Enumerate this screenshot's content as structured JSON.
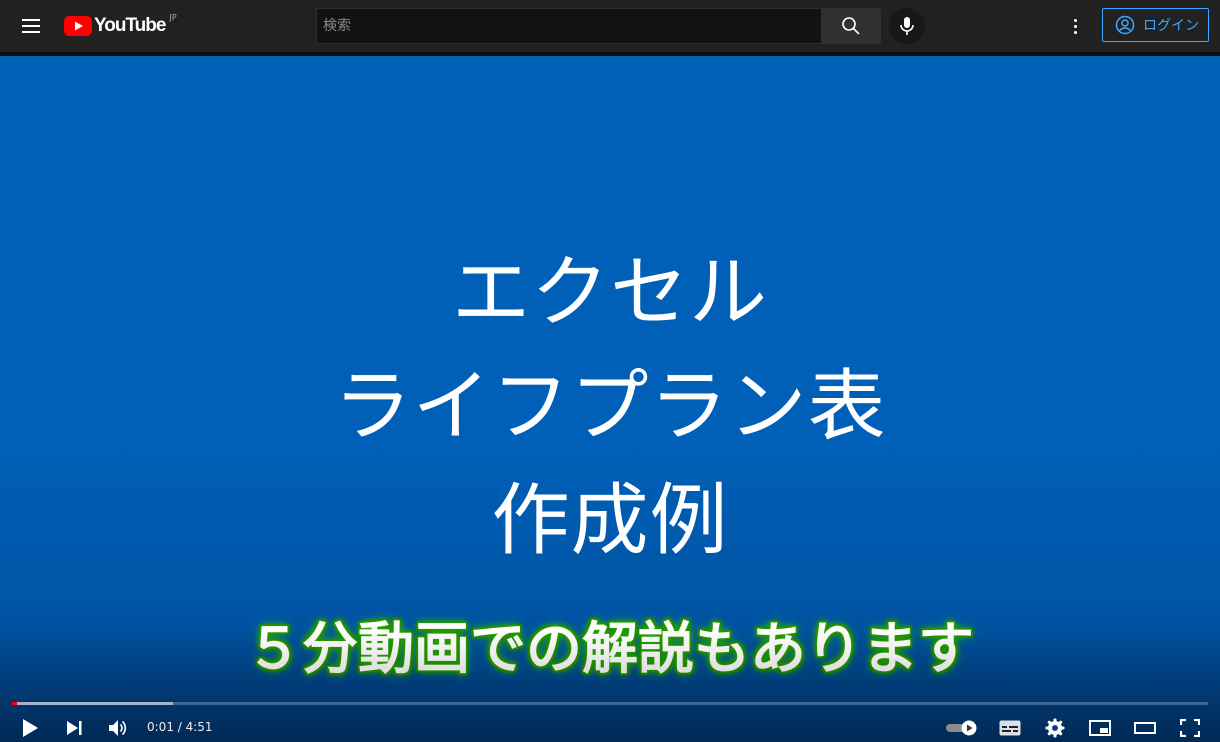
{
  "header": {
    "logo_text": "YouTube",
    "region": "JP",
    "search": {
      "placeholder": "検索",
      "value": ""
    },
    "login_label": "ログイン",
    "icons": [
      "menu-icon",
      "youtube-logo-icon",
      "search-icon",
      "microphone-icon",
      "more-vert-icon",
      "account-circle-icon"
    ]
  },
  "video": {
    "title_lines": [
      "エクセル",
      "ライフプラン表",
      "作成例"
    ],
    "caption": "５分動画での解説もあります",
    "background_color": "#0061b8",
    "caption_glow_color": "#2aa800"
  },
  "player": {
    "time_display": "0:01 / 4:51",
    "progress_played_fraction": 0.004,
    "progress_buffered_fraction": 0.135,
    "progress_color": "#ff0000",
    "controls": [
      "play-icon",
      "next-icon",
      "volume-icon",
      "autoplay-toggle",
      "subtitles-icon",
      "settings-icon",
      "miniplayer-icon",
      "theater-mode-icon",
      "fullscreen-icon"
    ]
  }
}
